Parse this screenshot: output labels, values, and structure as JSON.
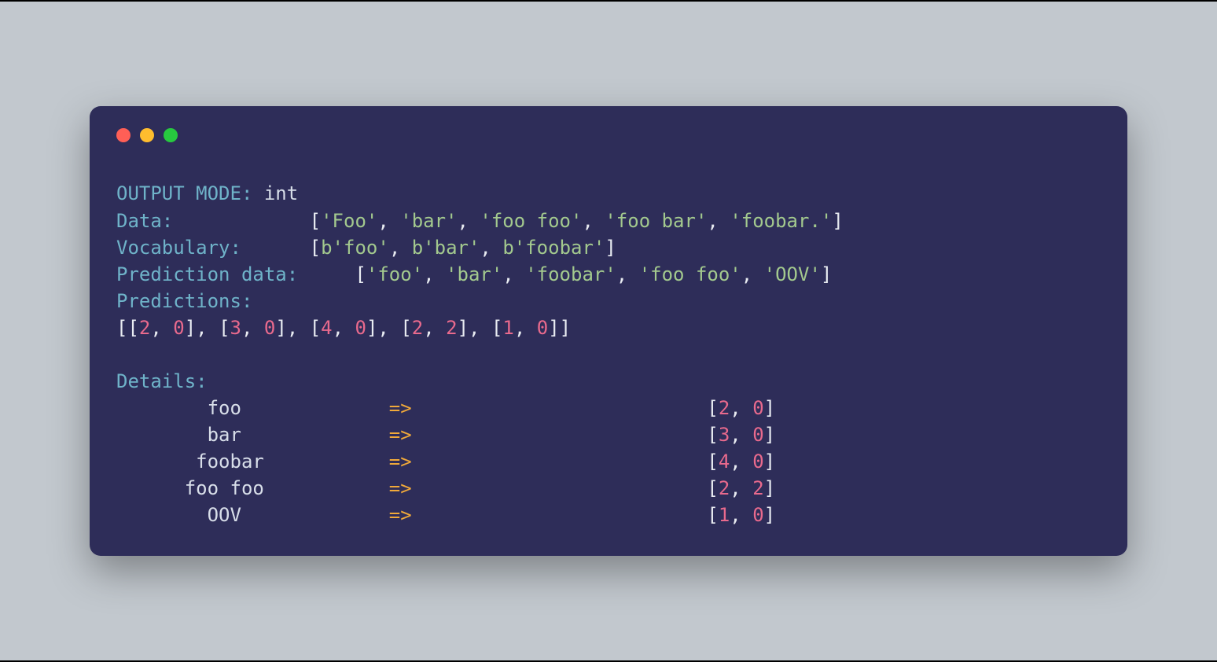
{
  "output_mode_label": "OUTPUT MODE:",
  "output_mode_value": "int",
  "data_label": "Data:",
  "data_items": [
    "'Foo'",
    "'bar'",
    "'foo foo'",
    "'foo bar'",
    "'foobar.'"
  ],
  "vocab_label": "Vocabulary:",
  "vocab_items": [
    "b'foo'",
    "b'bar'",
    "b'foobar'"
  ],
  "pred_data_label": "Prediction data:",
  "pred_data_items": [
    "'foo'",
    "'bar'",
    "'foobar'",
    "'foo foo'",
    "'OOV'"
  ],
  "predictions_label": "Predictions:",
  "predictions": [
    [
      2,
      0
    ],
    [
      3,
      0
    ],
    [
      4,
      0
    ],
    [
      2,
      2
    ],
    [
      1,
      0
    ]
  ],
  "details_label": "Details:",
  "details": [
    {
      "term": "foo",
      "pred": [
        2,
        0
      ]
    },
    {
      "term": "bar",
      "pred": [
        3,
        0
      ]
    },
    {
      "term": "foobar",
      "pred": [
        4,
        0
      ]
    },
    {
      "term": "foo foo",
      "pred": [
        2,
        2
      ]
    },
    {
      "term": "OOV",
      "pred": [
        1,
        0
      ]
    }
  ],
  "arrow": "=>"
}
